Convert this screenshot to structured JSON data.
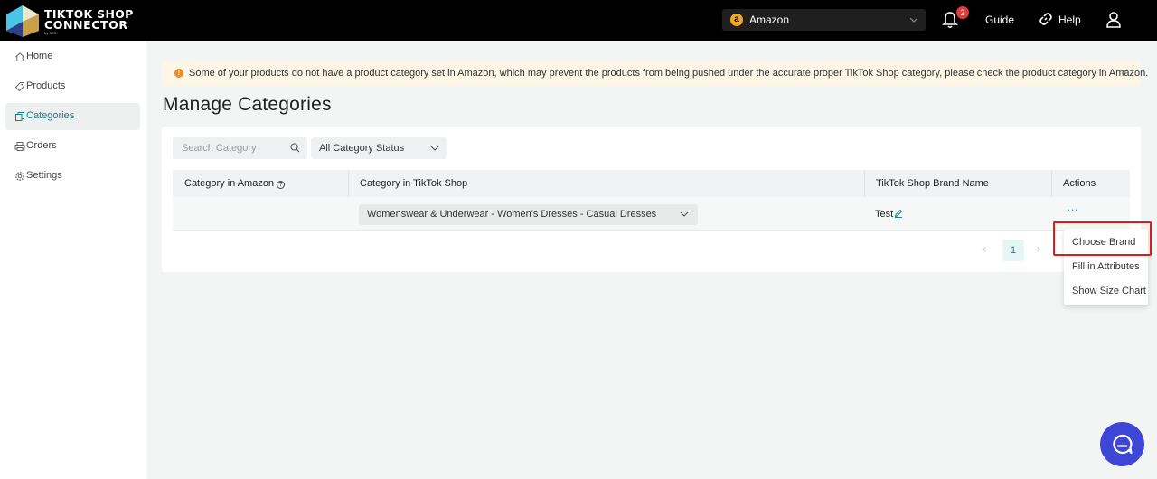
{
  "brand": {
    "line1": "TIKTOK SHOP",
    "line2": "CONNECTOR",
    "line3": "by SCS"
  },
  "topbar": {
    "store": "Amazon",
    "store_icon": "a",
    "notification_count": "2",
    "guide": "Guide",
    "help": "Help"
  },
  "sidebar": {
    "items": [
      {
        "label": "Home",
        "icon": "home-icon"
      },
      {
        "label": "Products",
        "icon": "tag-icon"
      },
      {
        "label": "Categories",
        "icon": "copy-icon"
      },
      {
        "label": "Orders",
        "icon": "printer-icon"
      },
      {
        "label": "Settings",
        "icon": "gear-icon"
      }
    ]
  },
  "banner": {
    "icon": "!",
    "text": "Some of your products do not have a product category set in Amazon, which may prevent the products from being pushed under the accurate proper TikTok Shop category, please check the product category in Amazon.",
    "close": "×"
  },
  "page": {
    "title": "Manage Categories"
  },
  "filters": {
    "search_placeholder": "Search Category",
    "status": "All Category Status"
  },
  "table": {
    "headers": [
      "Category in Amazon",
      "Category in TikTok Shop",
      "TikTok Shop Brand Name",
      "Actions"
    ],
    "rows": [
      {
        "amazon": "",
        "tiktok": "Womenswear & Underwear - Women's Dresses - Casual Dresses",
        "brand": "Test",
        "actions": "···"
      }
    ]
  },
  "pagination": {
    "prev": "‹",
    "current": "1",
    "next": "›"
  },
  "dropdown": {
    "items": [
      "Choose Brand",
      "Fill in Attributes",
      "Show Size Chart"
    ]
  },
  "colors": {
    "accent": "#1a7f86",
    "highlight": "#e0191a",
    "chat": "#3d46d6"
  }
}
